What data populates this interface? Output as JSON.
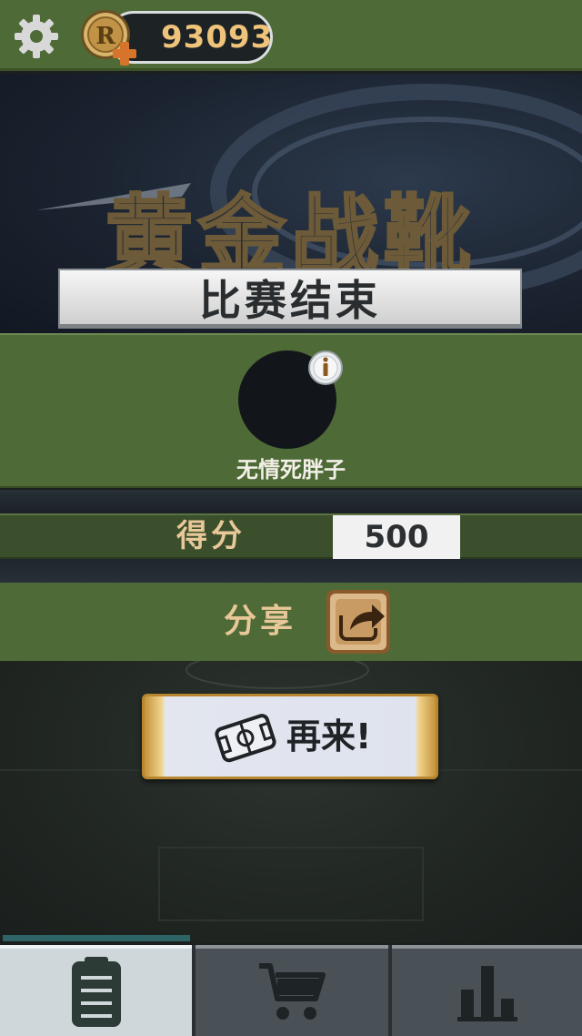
{
  "header": {
    "coins": "93093",
    "settings_icon": "gear-icon",
    "coin_icon": "r-coin-icon",
    "add_icon": "plus-icon"
  },
  "banner": {
    "event_title": "黄金战靴",
    "result_title": "比赛结束"
  },
  "player": {
    "name": "无情死胖子",
    "info_icon": "info-icon"
  },
  "score": {
    "label": "得分",
    "value": "500"
  },
  "share": {
    "label": "分享",
    "icon": "share-arrow-icon"
  },
  "replay": {
    "label": "再来!",
    "icon": "football-pitch-icon"
  },
  "nav": {
    "tabs": [
      {
        "icon": "clipboard-icon",
        "active": true
      },
      {
        "icon": "shopping-cart-icon",
        "active": false
      },
      {
        "icon": "leaderboard-icon",
        "active": false
      }
    ],
    "progress_fraction": 0.33
  },
  "colors": {
    "panel_green": "#4e6a36",
    "gold_text": "#e8c898",
    "coin_text": "#f0c37a"
  }
}
